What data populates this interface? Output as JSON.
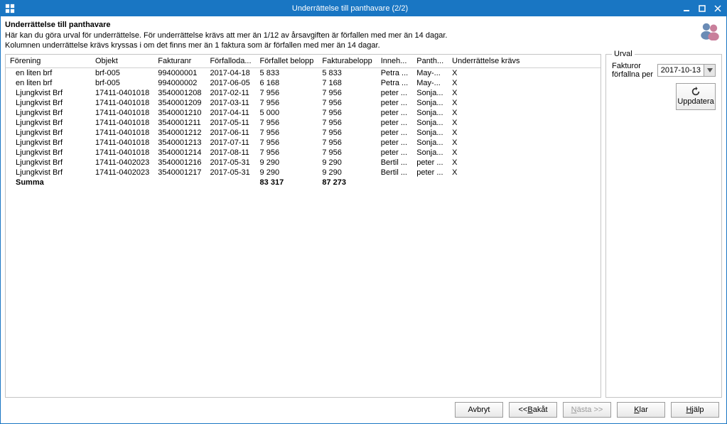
{
  "window": {
    "title": "Underrättelse till panthavare (2/2)"
  },
  "header": {
    "heading": "Underrättelse till panthavare",
    "line1": "Här kan du göra urval för underrättelse. För underrättelse krävs att mer än 1/12 av årsavgiften är förfallen med mer än 14 dagar.",
    "line2": "Kolumnen underrättelse krävs kryssas i om det finns mer än 1 faktura som är förfallen med mer än 14 dagar."
  },
  "columns": {
    "forening": "Förening",
    "objekt": "Objekt",
    "fakturanr": "Fakturanr",
    "forfalloda": "Förfalloda...",
    "forfallet_belopp": "Förfallet belopp",
    "fakturabelopp": "Fakturabelopp",
    "inneh": "Inneh...",
    "panth": "Panth...",
    "underrattelse_kravs": "Underrättelse krävs"
  },
  "rows": [
    {
      "forening": "en liten brf",
      "objekt": "brf-005",
      "fakturanr": "994000001",
      "forfalloda": "2017-04-18",
      "forfallet": "5 833",
      "faktura": "5 833",
      "inneh": "Petra ...",
      "panth": "May-...",
      "ukravs": "X"
    },
    {
      "forening": "en liten brf",
      "objekt": "brf-005",
      "fakturanr": "994000002",
      "forfalloda": "2017-06-05",
      "forfallet": "6 168",
      "faktura": "7 168",
      "inneh": "Petra ...",
      "panth": "May-...",
      "ukravs": "X"
    },
    {
      "forening": "Ljungkvist Brf",
      "objekt": "17411-0401018",
      "fakturanr": "3540001208",
      "forfalloda": "2017-02-11",
      "forfallet": "7 956",
      "faktura": "7 956",
      "inneh": "peter ...",
      "panth": "Sonja...",
      "ukravs": "X"
    },
    {
      "forening": "Ljungkvist Brf",
      "objekt": "17411-0401018",
      "fakturanr": "3540001209",
      "forfalloda": "2017-03-11",
      "forfallet": "7 956",
      "faktura": "7 956",
      "inneh": "peter ...",
      "panth": "Sonja...",
      "ukravs": "X"
    },
    {
      "forening": "Ljungkvist Brf",
      "objekt": "17411-0401018",
      "fakturanr": "3540001210",
      "forfalloda": "2017-04-11",
      "forfallet": "5 000",
      "faktura": "7 956",
      "inneh": "peter ...",
      "panth": "Sonja...",
      "ukravs": "X"
    },
    {
      "forening": "Ljungkvist Brf",
      "objekt": "17411-0401018",
      "fakturanr": "3540001211",
      "forfalloda": "2017-05-11",
      "forfallet": "7 956",
      "faktura": "7 956",
      "inneh": "peter ...",
      "panth": "Sonja...",
      "ukravs": "X"
    },
    {
      "forening": "Ljungkvist Brf",
      "objekt": "17411-0401018",
      "fakturanr": "3540001212",
      "forfalloda": "2017-06-11",
      "forfallet": "7 956",
      "faktura": "7 956",
      "inneh": "peter ...",
      "panth": "Sonja...",
      "ukravs": "X"
    },
    {
      "forening": "Ljungkvist Brf",
      "objekt": "17411-0401018",
      "fakturanr": "3540001213",
      "forfalloda": "2017-07-11",
      "forfallet": "7 956",
      "faktura": "7 956",
      "inneh": "peter ...",
      "panth": "Sonja...",
      "ukravs": "X"
    },
    {
      "forening": "Ljungkvist Brf",
      "objekt": "17411-0401018",
      "fakturanr": "3540001214",
      "forfalloda": "2017-08-11",
      "forfallet": "7 956",
      "faktura": "7 956",
      "inneh": "peter ...",
      "panth": "Sonja...",
      "ukravs": "X"
    },
    {
      "forening": "Ljungkvist Brf",
      "objekt": "17411-0402023",
      "fakturanr": "3540001216",
      "forfalloda": "2017-05-31",
      "forfallet": "9 290",
      "faktura": "9 290",
      "inneh": "Bertil ...",
      "panth": "peter ...",
      "ukravs": "X"
    },
    {
      "forening": "Ljungkvist Brf",
      "objekt": "17411-0402023",
      "fakturanr": "3540001217",
      "forfalloda": "2017-05-31",
      "forfallet": "9 290",
      "faktura": "9 290",
      "inneh": "Bertil ...",
      "panth": "peter ...",
      "ukravs": "X"
    }
  ],
  "sum": {
    "label": "Summa",
    "forfallet": "83 317",
    "faktura": "87 273"
  },
  "urval": {
    "legend": "Urval",
    "fakturor_label": "Fakturor förfallna per",
    "date": "2017-10-13",
    "uppdatera": "Uppdatera"
  },
  "buttons": {
    "avbryt": "Avbryt",
    "bakat_prefix": "<< ",
    "bakat_u": "B",
    "bakat_rest": "akåt",
    "nasta_u": "N",
    "nasta_rest": "ästa >>",
    "klar_u": "K",
    "klar_rest": "lar",
    "hjalp_u": "H",
    "hjalp_rest": "jälp"
  }
}
